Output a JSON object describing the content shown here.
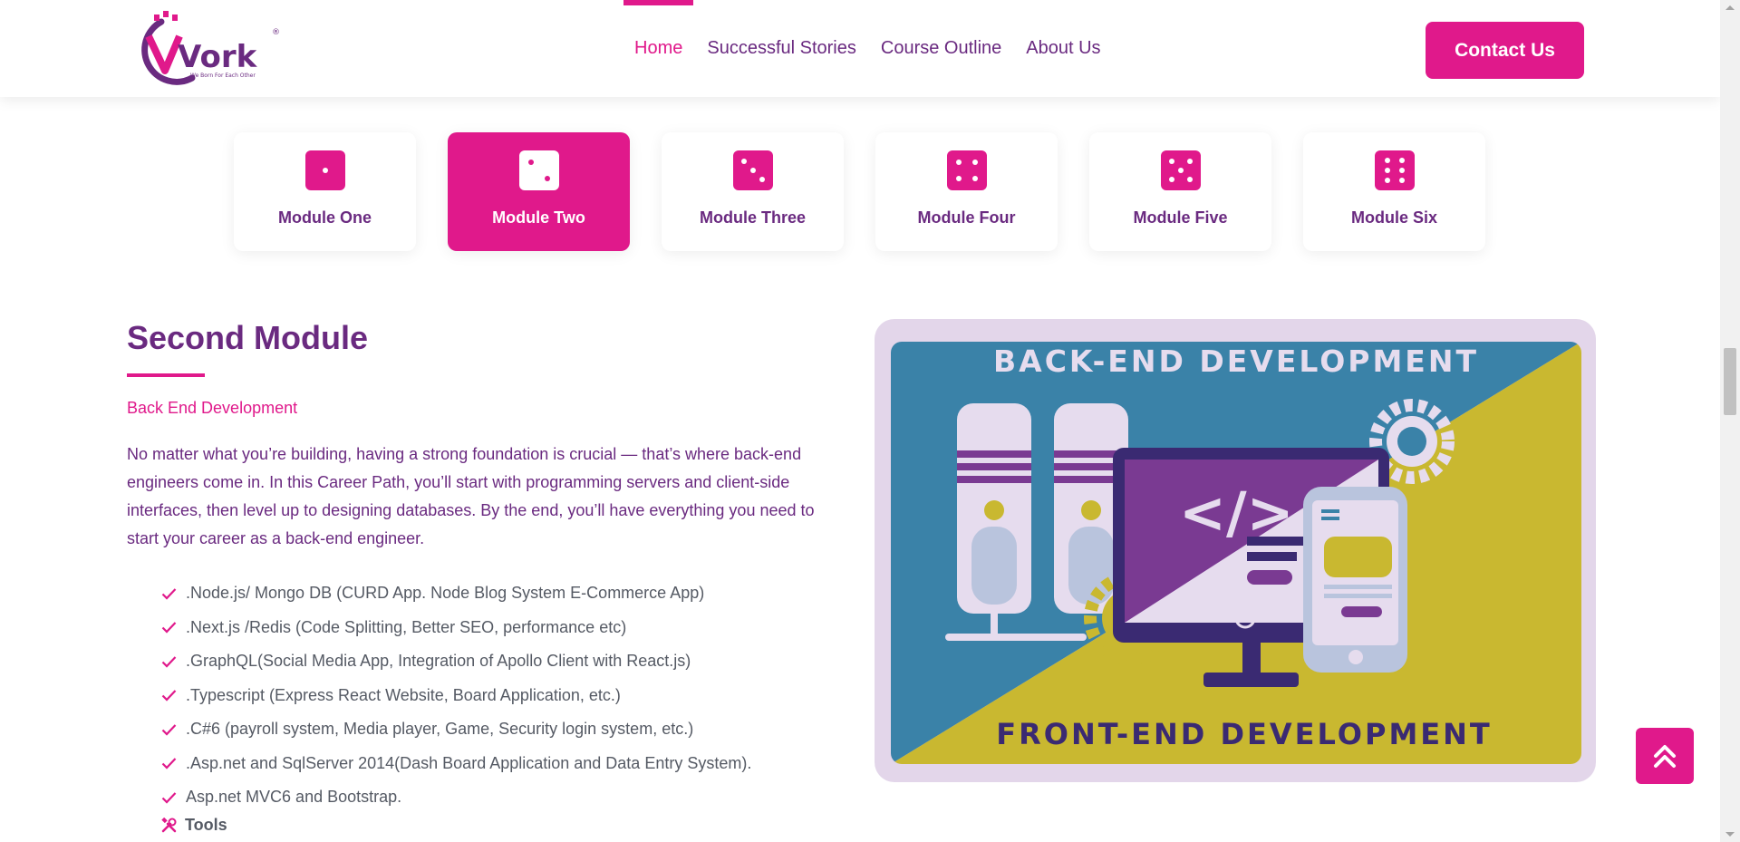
{
  "header": {
    "logo_text": "Vork",
    "logo_tagline": "We Born For Each Other",
    "nav": [
      {
        "label": "Home",
        "active": true
      },
      {
        "label": "Successful Stories",
        "active": false
      },
      {
        "label": "Course Outline",
        "active": false
      },
      {
        "label": "About Us",
        "active": false
      }
    ],
    "contact_label": "Contact Us"
  },
  "modules": [
    {
      "label": "Module One",
      "icon": "dice-one-icon",
      "active": false
    },
    {
      "label": "Module Two",
      "icon": "dice-two-icon",
      "active": true
    },
    {
      "label": "Module Three",
      "icon": "dice-three-icon",
      "active": false
    },
    {
      "label": "Module Four",
      "icon": "dice-four-icon",
      "active": false
    },
    {
      "label": "Module Five",
      "icon": "dice-five-icon",
      "active": false
    },
    {
      "label": "Module Six",
      "icon": "dice-six-icon",
      "active": false
    }
  ],
  "content": {
    "title": "Second Module",
    "subtitle": "Back End Development",
    "description": "No matter what you’re building, having a strong foundation is crucial — that’s where back-end engineers come in. In this Career Path, you’ll start with programming servers and client-side interfaces, then level up to designing databases. By the end, you’ll have everything you need to start your career as a back-end engineer.",
    "topics": [
      ".Node.js/ Mongo DB (CURD App. Node Blog System E-Commerce App)",
      ".Next.js /Redis (Code Splitting, Better SEO, performance etc)",
      ".GraphQL(Social Media App, Integration of Apollo Client with React.js)",
      ".Typescript (Express React Website, Board Application, etc.)",
      ".C#6 (payroll system, Media player, Game, Security login system, etc.)",
      ".Asp.net and SqlServer 2014(Dash Board Application and Data Entry System).",
      "Asp.net MVC6 and Bootstrap."
    ],
    "tools_label": "Tools"
  },
  "illustration": {
    "top_text": "BACK-END DEVELOPMENT",
    "bottom_text": "FRONT-END DEVELOPMENT",
    "code_text": "</>"
  },
  "colors": {
    "brand_pink": "#e0198b",
    "brand_purple": "#6a2a80"
  }
}
